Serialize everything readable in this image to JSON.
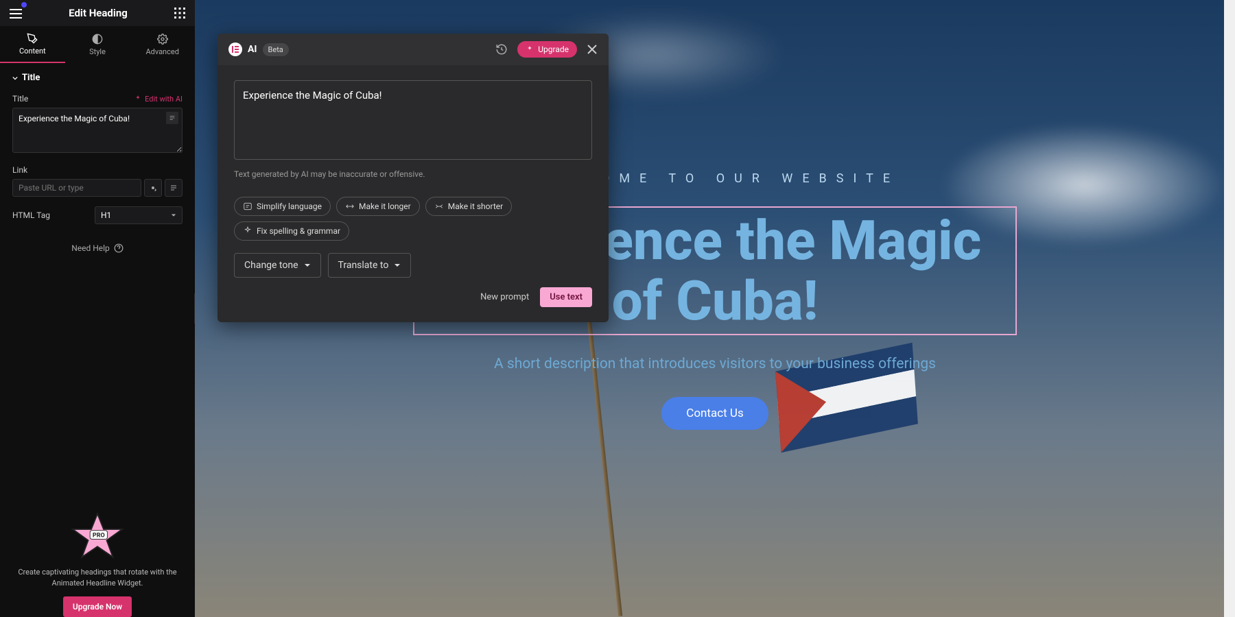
{
  "sidebar": {
    "header_title": "Edit Heading",
    "tabs": {
      "content": "Content",
      "style": "Style",
      "advanced": "Advanced"
    },
    "section_title": "Title",
    "title_label": "Title",
    "edit_ai": "Edit with AI",
    "title_value": "Experience the Magic of Cuba!",
    "link_label": "Link",
    "link_placeholder": "Paste URL or type",
    "tag_label": "HTML Tag",
    "tag_value": "H1",
    "help": "Need Help",
    "promo_text": "Create captivating headings that rotate with the Animated Headline Widget.",
    "upgrade_now": "Upgrade Now"
  },
  "canvas": {
    "eyebrow": "WELCOME TO OUR WEBSITE",
    "heading": "Experience the Magic of Cuba!",
    "subheading": "A short description that introduces visitors to your business offerings",
    "cta": "Contact Us"
  },
  "ai": {
    "label": "AI",
    "beta": "Beta",
    "upgrade": "Upgrade",
    "text_value": "Experience the Magic of Cuba!",
    "disclaimer": "Text generated by AI may be inaccurate or offensive.",
    "chips": {
      "simplify": "Simplify language",
      "longer": "Make it longer",
      "shorter": "Make it shorter",
      "spelling": "Fix spelling & grammar"
    },
    "change_tone": "Change tone",
    "translate": "Translate to",
    "new_prompt": "New prompt",
    "use_text": "Use text"
  }
}
